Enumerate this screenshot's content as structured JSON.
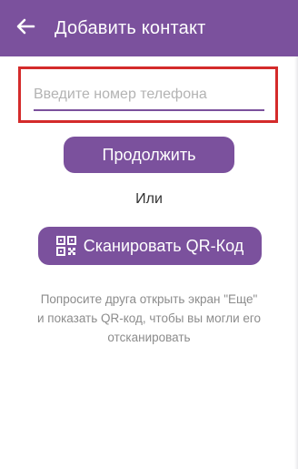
{
  "appbar": {
    "back_icon": "arrow-left-icon",
    "title": "Добавить контакт",
    "color": "#7b519d"
  },
  "phone": {
    "placeholder": "Введите номер телефона",
    "value": ""
  },
  "actions": {
    "continue_label": "Продолжить",
    "or_label": "Или",
    "qr_icon": "qr-code-icon",
    "qr_label": "Сканировать QR-Код"
  },
  "hint": "Попросите друга открыть экран \"Еще\" и показать QR-код, чтобы вы могли его отсканировать",
  "colors": {
    "accent": "#7b519d",
    "highlight_border": "#d42b2b"
  }
}
